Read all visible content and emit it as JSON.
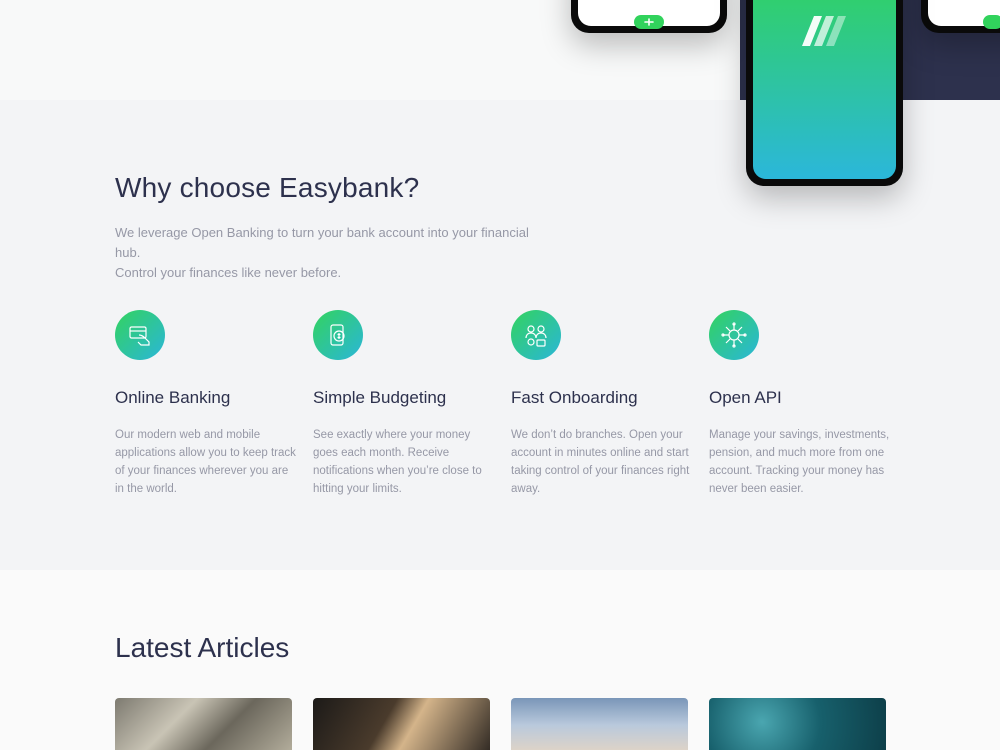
{
  "hero": {
    "phone_pill_symbol": "+"
  },
  "why": {
    "title": "Why choose Easybank?",
    "intro_line1": "We leverage Open Banking to turn your bank account into your financial hub.",
    "intro_line2": "Control your finances like never before."
  },
  "features": [
    {
      "icon": "online-banking-icon",
      "title": "Online Banking",
      "body": "Our modern web and mobile applications allow you to keep track of your finances wherever you are in the world."
    },
    {
      "icon": "budgeting-icon",
      "title": "Simple Budgeting",
      "body": "See exactly where your money goes each month. Receive notifications when you’re close to hitting your limits."
    },
    {
      "icon": "onboarding-icon",
      "title": "Fast Onboarding",
      "body": "We don’t do branches. Open your account in minutes online and start taking control of your finances right away."
    },
    {
      "icon": "api-icon",
      "title": "Open API",
      "body": "Manage your savings, investments, pension, and much more from one account. Tracking your money has never been easier."
    }
  ],
  "articles": {
    "title": "Latest Articles"
  },
  "colors": {
    "dark_blue": "#2d314d",
    "lime_green": "#31d35c",
    "bright_cyan": "#2bb7da",
    "grayish_blue": "#9698a6"
  }
}
